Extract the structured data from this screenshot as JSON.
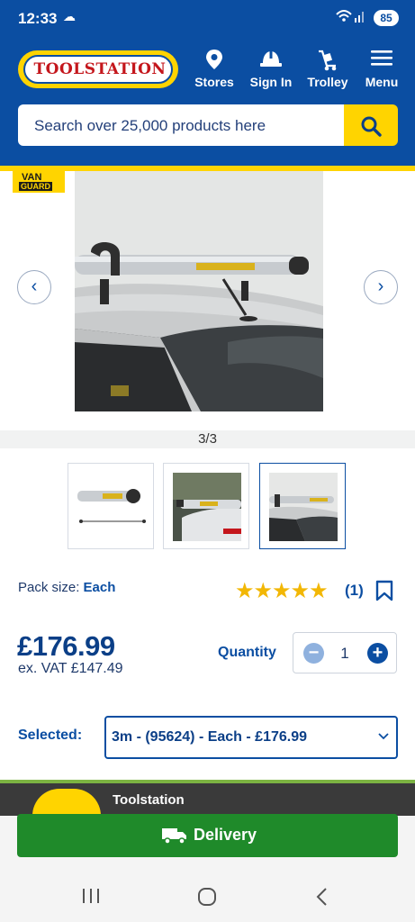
{
  "status_bar": {
    "time": "12:33",
    "battery": "85"
  },
  "header": {
    "logo_text": "TOOLSTATION",
    "nav": [
      {
        "label": "Stores",
        "icon": "location-pin-icon"
      },
      {
        "label": "Sign In",
        "icon": "hard-hat-icon"
      },
      {
        "label": "Trolley",
        "icon": "trolley-icon"
      },
      {
        "label": "Menu",
        "icon": "hamburger-menu-icon"
      }
    ],
    "search": {
      "placeholder": "Search over 25,000 products here",
      "button_icon": "search-icon"
    }
  },
  "gallery": {
    "brand_badge": [
      "VAN",
      "GUARD"
    ],
    "counter": "3/3",
    "selected_index": 2,
    "thumbnails": [
      "thumbnail-roof-tube",
      "thumbnail-van-side",
      "thumbnail-van-roof"
    ]
  },
  "product": {
    "pack_label": "Pack size:",
    "pack_value": "Each",
    "rating_stars": 5,
    "review_count": "(1)",
    "price": "£176.99",
    "ex_vat": "ex. VAT £147.49",
    "quantity_label": "Quantity",
    "quantity_value": "1",
    "selected_label": "Selected:",
    "selected_option": "3m - (95624) - Each - £176.99"
  },
  "bottom": {
    "promo_text": "Toolstation ",
    "delivery_label": "Delivery"
  },
  "colors": {
    "brand_blue": "#0b4ea2",
    "brand_yellow": "#ffd400",
    "delivery_green": "#1f8a2a",
    "star_yellow": "#f2b705"
  }
}
